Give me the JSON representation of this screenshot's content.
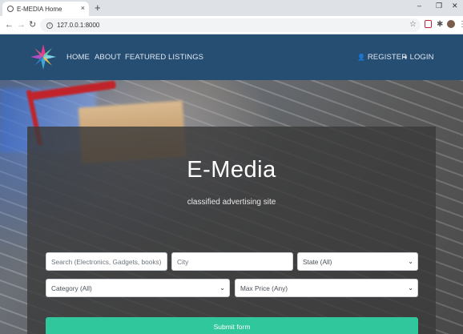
{
  "browser": {
    "tab_title": "E-MEDIA Home",
    "tab_close": "×",
    "new_tab": "+",
    "window_minimize": "–",
    "window_maximize": "❐",
    "window_close": "✕",
    "back": "←",
    "forward": "→",
    "reload": "↻",
    "url": "127.0.0.1:8000",
    "info_glyph": "i",
    "star": "☆",
    "extensions": "✱",
    "menu": "⋮"
  },
  "nav": {
    "home": "HOME",
    "about": "ABOUT",
    "featured": "FEATURED LISTINGS",
    "register": "REGISTER",
    "login": "LOGIN",
    "register_icon_glyph": "👤",
    "login_icon_glyph": "➜"
  },
  "hero": {
    "title": "E-Media",
    "subtitle": "classified advertising site"
  },
  "form": {
    "search_placeholder": "Search (Electronics, Gadgets, books)",
    "city_placeholder": "City",
    "state_value": "State (All)",
    "category_value": "Category (All)",
    "max_price_value": "Max Price (Any)",
    "submit_label": "Submit form",
    "caret": "⌄"
  },
  "colors": {
    "navbar": "#264d72",
    "submit": "#2fc79b"
  }
}
